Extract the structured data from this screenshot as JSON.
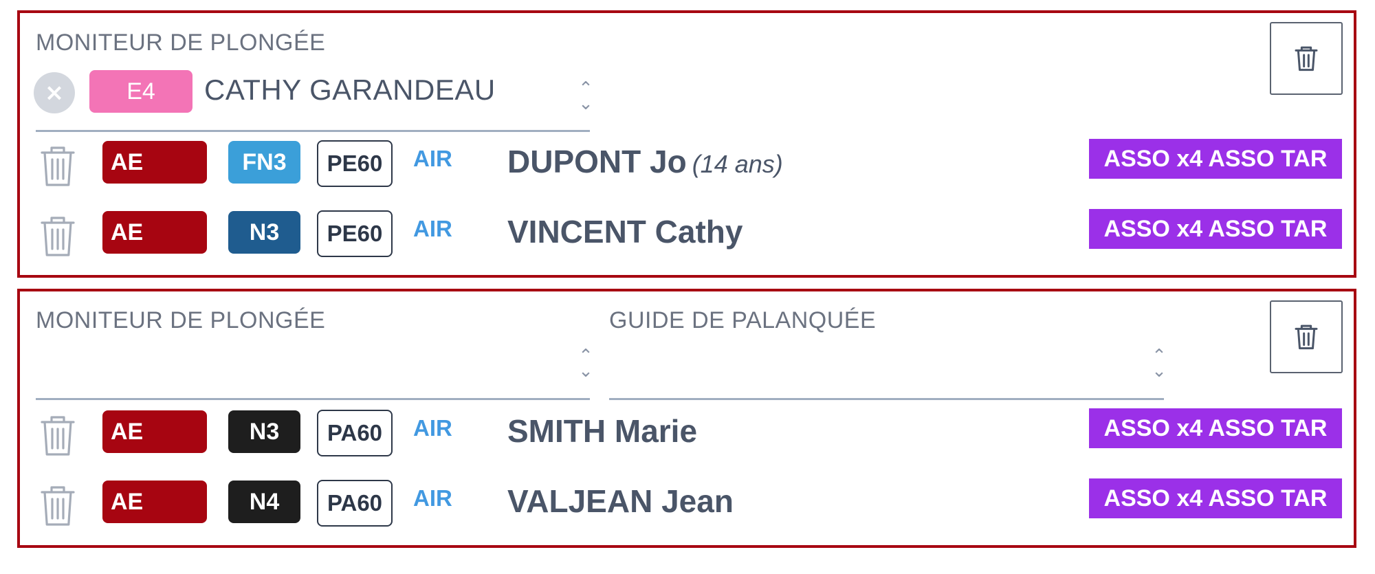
{
  "groups": [
    {
      "moniteur_label": "MONITEUR DE PLONGÉE",
      "moniteur": {
        "level": "E4",
        "name": "CATHY GARANDEAU",
        "clear_icon": "×"
      },
      "divers": [
        {
          "aptitude": "AE",
          "level": "FN3",
          "level_color": "#3b9fd9",
          "depth": "PE60",
          "gas": "AIR",
          "name": "DUPONT Jo",
          "age": "(14 ans)",
          "tarif": "ASSO x4 ASSO TAR"
        },
        {
          "aptitude": "AE",
          "level": "N3",
          "level_color": "#1f5c8f",
          "depth": "PE60",
          "gas": "AIR",
          "name": "VINCENT Cathy",
          "age": "",
          "tarif": "ASSO x4 ASSO TAR"
        }
      ]
    },
    {
      "moniteur_label": "MONITEUR DE PLONGÉE",
      "guide_label": "GUIDE DE PALANQUÉE",
      "divers": [
        {
          "aptitude": "AE",
          "level": "N3",
          "level_color": "#1e1e1e",
          "depth": "PA60",
          "gas": "AIR",
          "name": "SMITH Marie",
          "age": "",
          "tarif": "ASSO x4 ASSO TAR"
        },
        {
          "aptitude": "AE",
          "level": "N4",
          "level_color": "#1e1e1e",
          "depth": "PA60",
          "gas": "AIR",
          "name": "VALJEAN Jean",
          "age": "",
          "tarif": "ASSO x4 ASSO TAR"
        }
      ]
    }
  ],
  "colors": {
    "border": "#a70511",
    "aptitude_bg": "#a70511",
    "tarif_bg": "#9b30e8",
    "gas": "#4299e1",
    "e4_badge": "#f374b6"
  },
  "icons": {
    "delete_group": "trash-icon",
    "delete_diver": "trash-outline-icon",
    "clear": "close-icon",
    "select": "chevron-up-down-icon"
  }
}
